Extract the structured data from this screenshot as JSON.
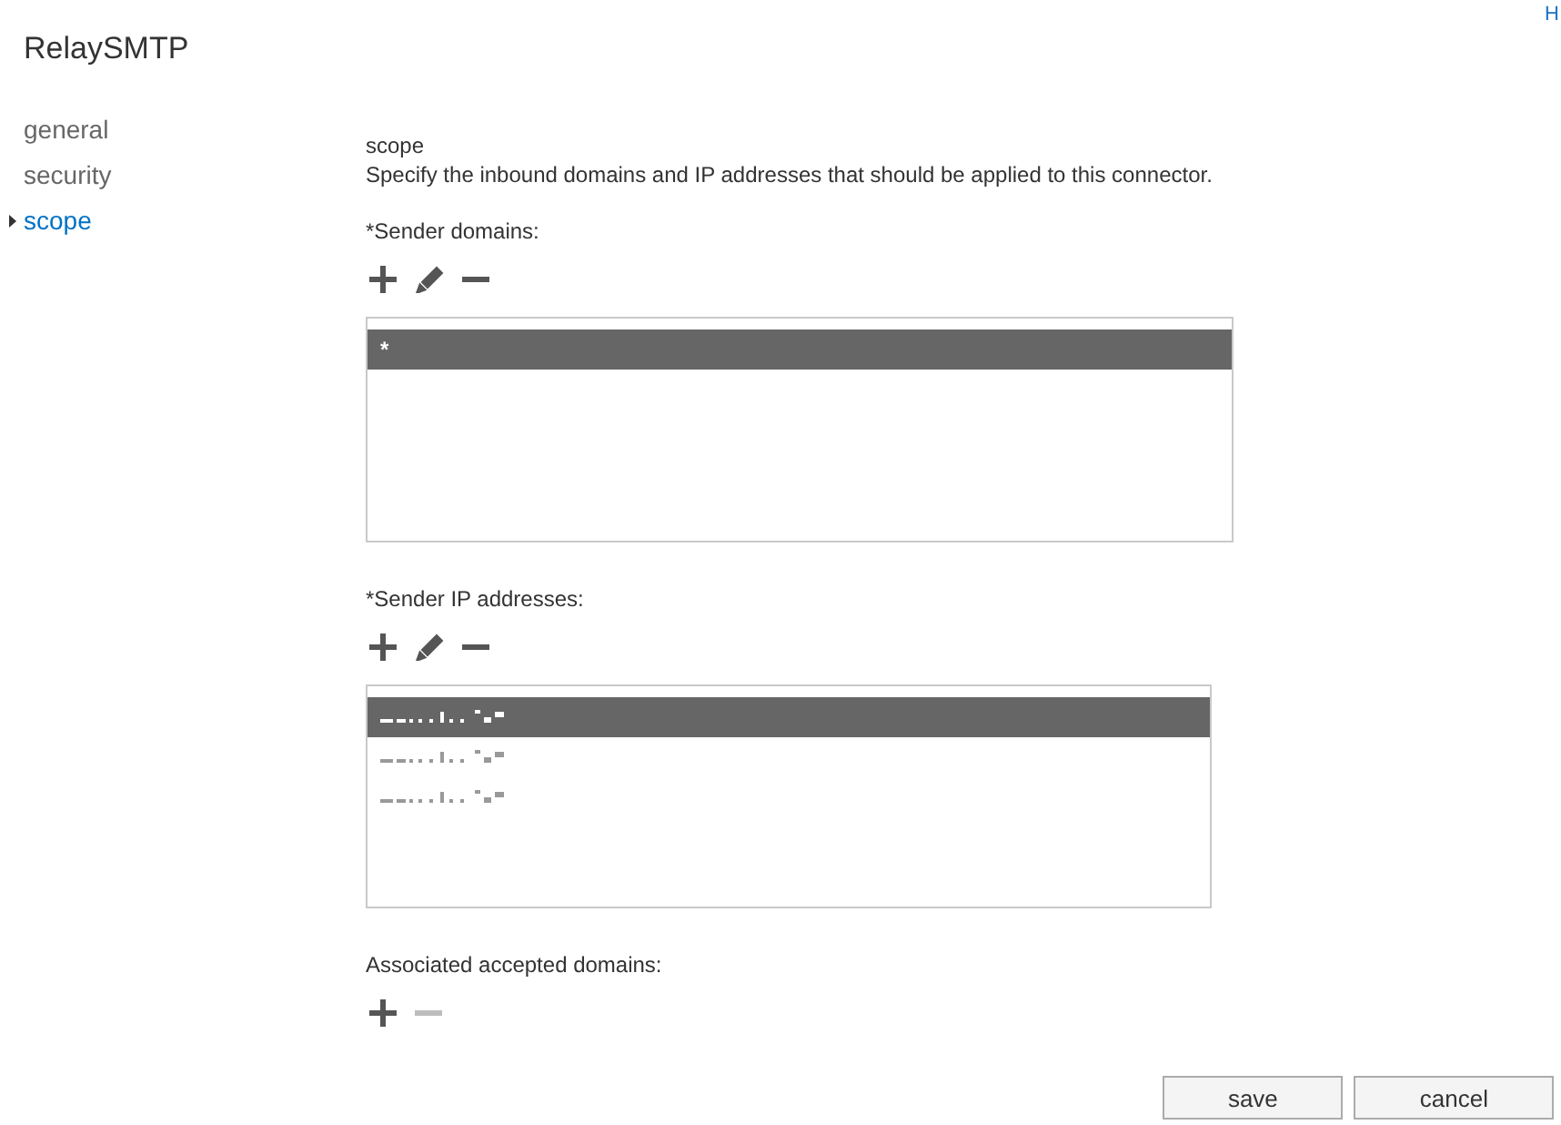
{
  "window": {
    "title": "RelaySMTP"
  },
  "help_link": "H",
  "nav": [
    {
      "label": "general",
      "selected": false
    },
    {
      "label": "security",
      "selected": false
    },
    {
      "label": "scope",
      "selected": true
    }
  ],
  "section": {
    "heading": "scope",
    "description": "Specify the inbound domains and IP addresses that should be applied to this connector."
  },
  "sender_domains": {
    "label": "*Sender domains:",
    "toolbar": [
      {
        "kind": "add",
        "disabled": false
      },
      {
        "kind": "edit",
        "disabled": false
      },
      {
        "kind": "remove",
        "disabled": false
      }
    ],
    "rows": [
      {
        "text": "*",
        "selected": true
      }
    ]
  },
  "sender_ip_addresses": {
    "label": "*Sender IP addresses:",
    "toolbar": [
      {
        "kind": "add",
        "disabled": false
      },
      {
        "kind": "edit",
        "disabled": false
      },
      {
        "kind": "remove",
        "disabled": false
      }
    ],
    "rows": [
      {
        "redacted": true,
        "selected": true
      },
      {
        "redacted": true,
        "selected": false
      },
      {
        "redacted": true,
        "selected": false
      }
    ]
  },
  "accepted_domains": {
    "label": "Associated accepted domains:",
    "toolbar": [
      {
        "kind": "add",
        "disabled": false
      },
      {
        "kind": "remove",
        "disabled": true
      }
    ]
  },
  "buttons": [
    {
      "label": "save"
    },
    {
      "label": "cancel"
    }
  ]
}
